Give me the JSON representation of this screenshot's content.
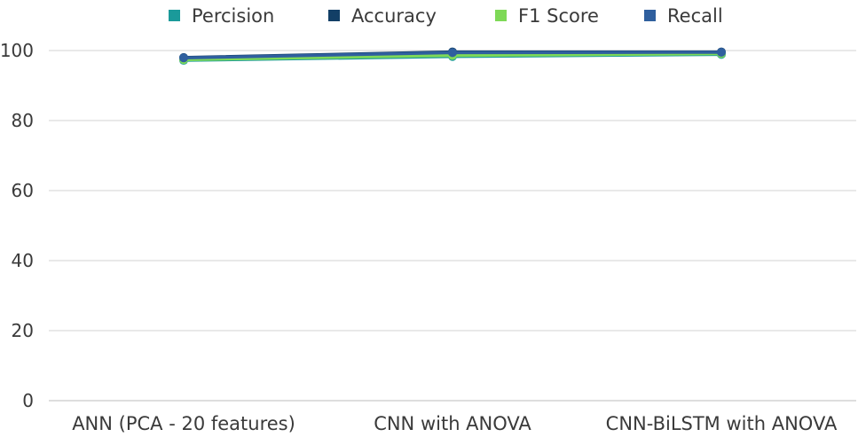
{
  "chart_data": {
    "type": "line",
    "categories": [
      "ANN (PCA - 20 features)",
      "CNN with ANOVA",
      "CNN-BiLSTM with ANOVA"
    ],
    "series": [
      {
        "name": "Percision",
        "color": "#1a9a9a",
        "values": [
          97.2,
          98.3,
          98.9
        ]
      },
      {
        "name": "Accuracy",
        "color": "#123f66",
        "values": [
          98.0,
          99.6,
          99.6
        ]
      },
      {
        "name": "F1 Score",
        "color": "#7ed957",
        "values": [
          97.4,
          98.6,
          99.1
        ]
      },
      {
        "name": "Recall",
        "color": "#2f5f9e",
        "values": [
          97.9,
          99.4,
          99.5
        ]
      }
    ],
    "yticks": [
      0,
      20,
      40,
      60,
      80,
      100
    ],
    "ylim": [
      0,
      100
    ],
    "grid": true,
    "legend": "top-center"
  }
}
